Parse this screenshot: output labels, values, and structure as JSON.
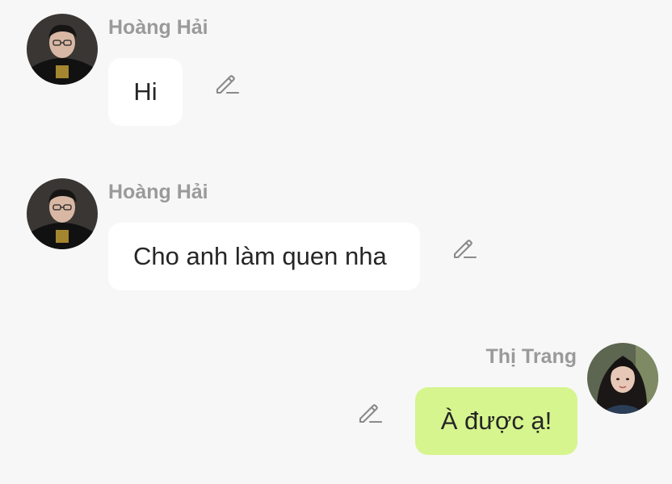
{
  "messages": [
    {
      "sender": "Hoàng Hải",
      "text": "Hi",
      "side": "left",
      "avatar_icon": "male-profile-avatar",
      "edit_icon": "pencil-edit-icon"
    },
    {
      "sender": "Hoàng Hải",
      "text": "Cho anh làm quen nha",
      "side": "left",
      "avatar_icon": "male-profile-avatar",
      "edit_icon": "pencil-edit-icon"
    },
    {
      "sender": "Thị Trang",
      "text": "À được ạ!",
      "side": "right",
      "avatar_icon": "female-profile-avatar",
      "edit_icon": "pencil-edit-icon"
    }
  ],
  "colors": {
    "background": "#f7f7f7",
    "incoming_bubble": "#ffffff",
    "outgoing_bubble": "#d6f58e",
    "sender_name": "#9a9a9a",
    "message_text": "#262626",
    "icon": "#8a8a8a"
  }
}
